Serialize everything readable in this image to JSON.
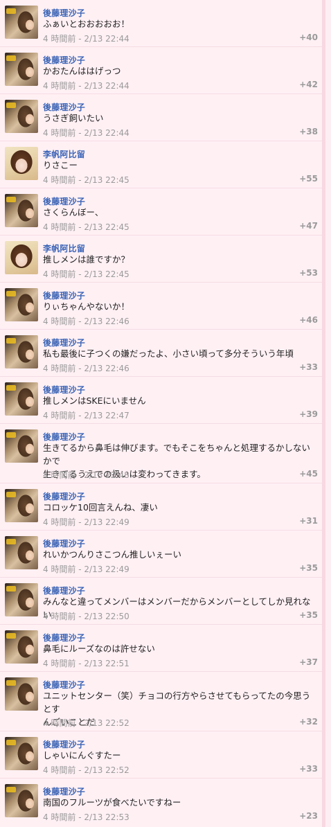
{
  "posts": [
    {
      "name": "後藤理沙子",
      "avatar": "goto-avatar",
      "lines": [
        "ふぁいとおおおおお！"
      ],
      "time": "4 時間前 - 2/13 22:44",
      "points": "+40"
    },
    {
      "name": "後藤理沙子",
      "avatar": "goto-avatar",
      "lines": [
        "かおたんははげっつ"
      ],
      "time": "4 時間前 - 2/13 22:44",
      "points": "+42"
    },
    {
      "name": "後藤理沙子",
      "avatar": "goto-avatar",
      "lines": [
        "うさぎ飼いたい"
      ],
      "time": "4 時間前 - 2/13 22:44",
      "points": "+38"
    },
    {
      "name": "李帆阿比留",
      "avatar": "ri-avatar",
      "lines": [
        "りさこー"
      ],
      "time": "4 時間前 - 2/13 22:45",
      "points": "+55"
    },
    {
      "name": "後藤理沙子",
      "avatar": "goto-avatar",
      "lines": [
        "さくらんぼー、"
      ],
      "time": "4 時間前 - 2/13 22:45",
      "points": "+47"
    },
    {
      "name": "李帆阿比留",
      "avatar": "ri-avatar",
      "lines": [
        "推しメンは誰ですか？"
      ],
      "time": "4 時間前 - 2/13 22:45",
      "points": "+53"
    },
    {
      "name": "後藤理沙子",
      "avatar": "goto-avatar",
      "lines": [
        "りぃちゃんやないか！"
      ],
      "time": "4 時間前 - 2/13 22:46",
      "points": "+46"
    },
    {
      "name": "後藤理沙子",
      "avatar": "goto-avatar",
      "lines": [
        "私も最後に子つくの嫌だったよ、小さい頃って多分そういう年頃"
      ],
      "time": "4 時間前 - 2/13 22:46",
      "points": "+33"
    },
    {
      "name": "後藤理沙子",
      "avatar": "goto-avatar",
      "lines": [
        "推しメンはSKEにいません"
      ],
      "time": "4 時間前 - 2/13 22:47",
      "points": "+39"
    },
    {
      "name": "後藤理沙子",
      "avatar": "goto-avatar",
      "lines": [
        "生きてるから鼻毛は伸びます。でもそこをちゃんと処理するかしないかで",
        "生きてるうえでの扱いは変わってきます。"
      ],
      "time": "4 時間前 - 2/13 22:48",
      "points": "+45"
    },
    {
      "name": "後藤理沙子",
      "avatar": "goto-avatar",
      "lines": [
        "コロッケ10回言えんね、凄い"
      ],
      "time": "4 時間前 - 2/13 22:49",
      "points": "+31"
    },
    {
      "name": "後藤理沙子",
      "avatar": "goto-avatar",
      "lines": [
        "れいかつんりさこつん推しいぇーい"
      ],
      "time": "4 時間前 - 2/13 22:49",
      "points": "+35"
    },
    {
      "name": "後藤理沙子",
      "avatar": "goto-avatar",
      "lines": [
        "みんなと違ってメンバーはメンバーだからメンバーとしてしか見れない"
      ],
      "time": "4 時間前 - 2/13 22:50",
      "points": "+35"
    },
    {
      "name": "後藤理沙子",
      "avatar": "goto-avatar",
      "lines": [
        "鼻毛にルーズなのは許せない"
      ],
      "time": "4 時間前 - 2/13 22:51",
      "points": "+37"
    },
    {
      "name": "後藤理沙子",
      "avatar": "goto-avatar",
      "lines": [
        "ユニットセンター（笑）チョコの行方やらさせてもらってたの今思うとす",
        "んごいことだ"
      ],
      "time": "4 時間前 - 2/13 22:52",
      "points": "+32"
    },
    {
      "name": "後藤理沙子",
      "avatar": "goto-avatar",
      "lines": [
        "しゃいにんぐすたー"
      ],
      "time": "4 時間前 - 2/13 22:52",
      "points": "+33"
    },
    {
      "name": "後藤理沙子",
      "avatar": "goto-avatar",
      "lines": [
        "南国のフルーツが食べたいですねー"
      ],
      "time": "4 時間前 - 2/13 22:53",
      "points": "+23"
    }
  ]
}
